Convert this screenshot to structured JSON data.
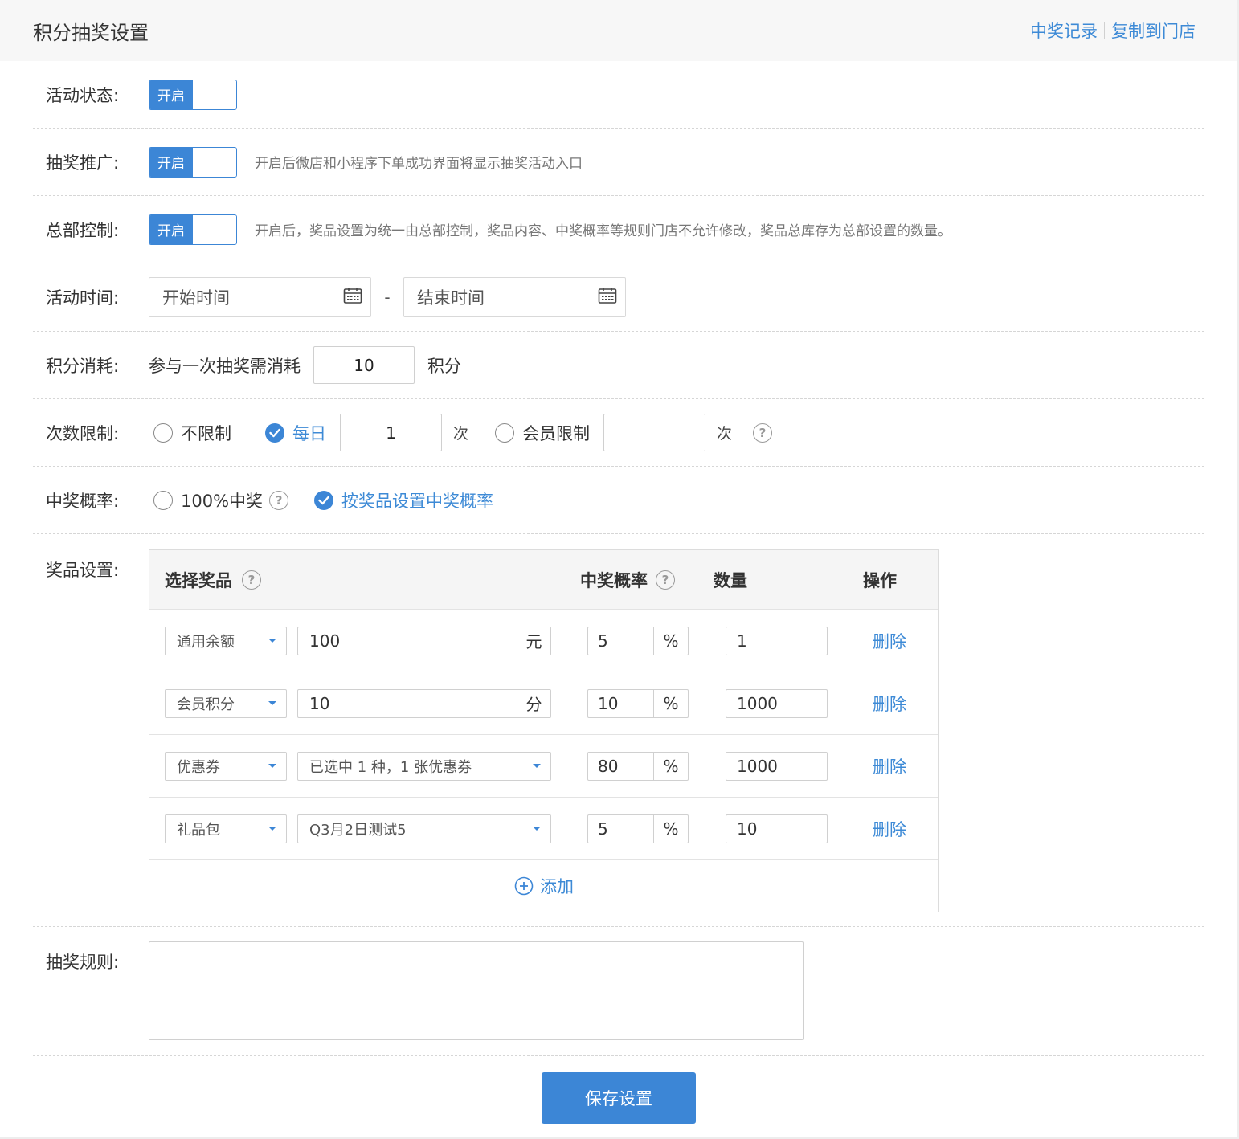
{
  "header": {
    "title": "积分抽奖设置",
    "links": [
      "中奖记录",
      "复制到门店"
    ]
  },
  "form": {
    "status": {
      "label": "活动状态:",
      "switch_on": "开启"
    },
    "promo": {
      "label": "抽奖推广:",
      "switch_on": "开启",
      "hint": "开启后微店和小程序下单成功界面将显示抽奖活动入口"
    },
    "hq": {
      "label": "总部控制:",
      "switch_on": "开启",
      "hint": "开启后，奖品设置为统一由总部控制，奖品内容、中奖概率等规则门店不允许修改，奖品总库存为总部设置的数量。"
    },
    "time": {
      "label": "活动时间:",
      "start_placeholder": "开始时间",
      "end_placeholder": "结束时间",
      "separator": "-"
    },
    "points": {
      "label": "积分消耗:",
      "prefix": "参与一次抽奖需消耗",
      "value": "10",
      "suffix": "积分"
    },
    "limit": {
      "label": "次数限制:",
      "opt_unlimited": "不限制",
      "opt_daily": "每日",
      "daily_value": "1",
      "unit": "次",
      "opt_member": "会员限制",
      "member_value": "",
      "unit2": "次"
    },
    "prob": {
      "label": "中奖概率:",
      "opt_full": "100%中奖",
      "opt_by_prize": "按奖品设置中奖概率"
    },
    "prizes": {
      "label": "奖品设置:",
      "headers": {
        "choose": "选择奖品",
        "rate": "中奖概率",
        "qty": "数量",
        "op": "操作"
      },
      "rows": [
        {
          "type": "通用余额",
          "value": "100",
          "unit": "元",
          "rate": "5",
          "qty": "1",
          "del": "删除"
        },
        {
          "type": "会员积分",
          "value": "10",
          "unit": "分",
          "rate": "10",
          "qty": "1000",
          "del": "删除"
        },
        {
          "type": "优惠券",
          "value": "已选中 1 种，1 张优惠券",
          "unit": "",
          "rate": "80",
          "qty": "1000",
          "del": "删除"
        },
        {
          "type": "礼品包",
          "value": "Q3月2日测试5",
          "unit": "",
          "rate": "5",
          "qty": "10",
          "del": "删除"
        }
      ],
      "percent": "%",
      "add": "添加"
    },
    "rules": {
      "label": "抽奖规则:",
      "value": ""
    },
    "save": "保存设置"
  },
  "colors": {
    "accent": "#3c86d6",
    "link": "#3d8ad6",
    "header_bg": "#f7f7f7"
  }
}
